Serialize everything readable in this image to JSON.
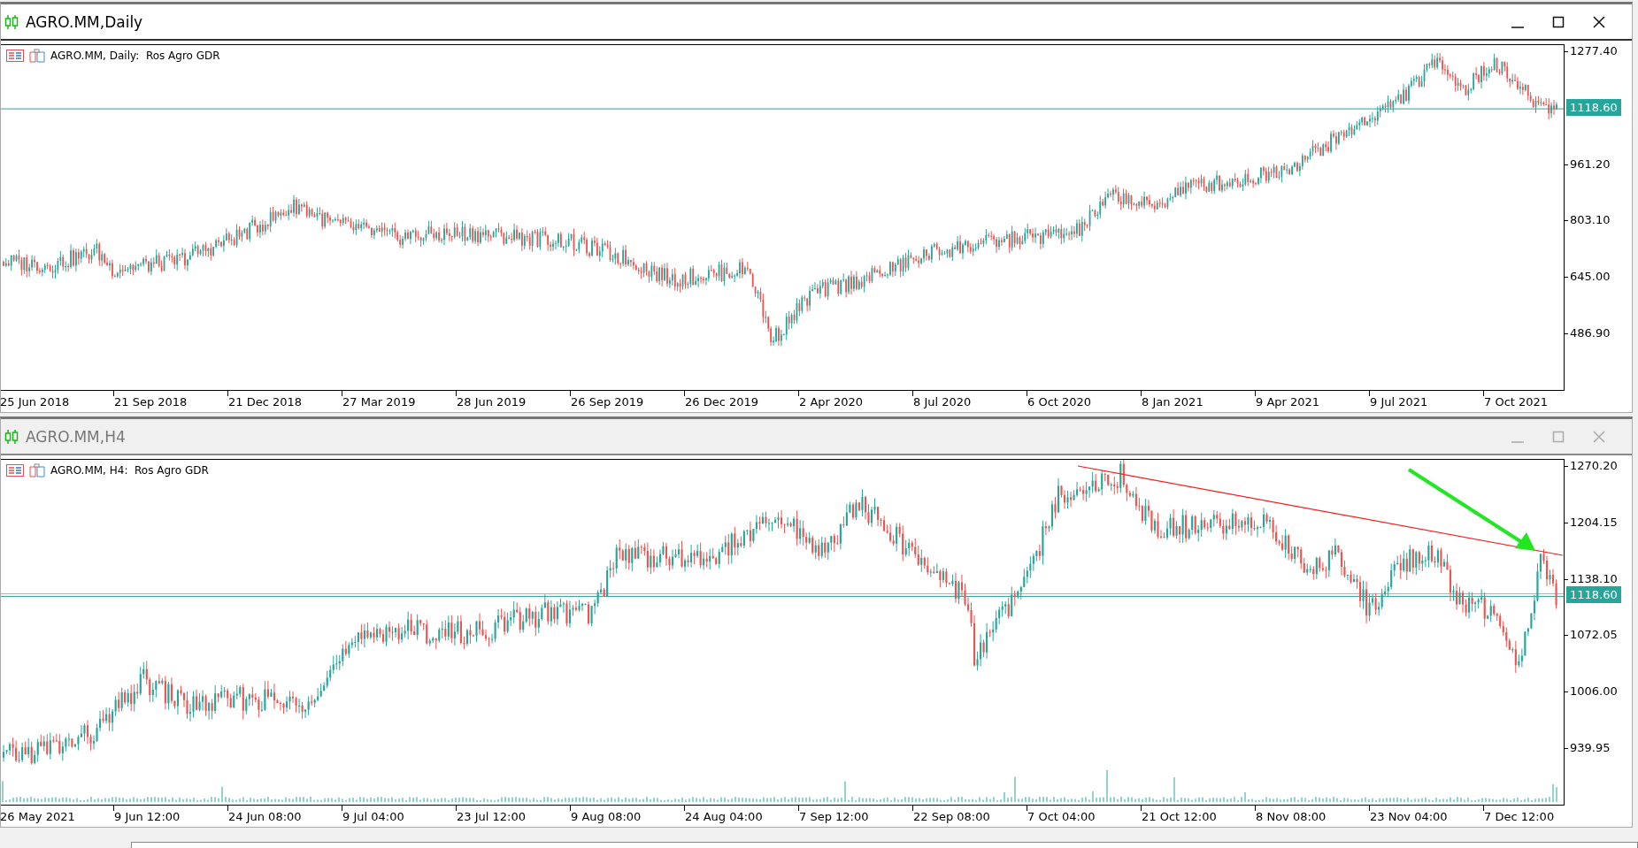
{
  "windows": [
    {
      "kind": "daily",
      "title": "AGRO.MM,Daily",
      "active": true,
      "legend": "AGRO.MM, Daily:  Ros Agro GDR",
      "price_axis": [
        "1277.40",
        "961.20",
        "803.10",
        "645.00",
        "486.90"
      ],
      "current_price": "1118.60",
      "time_axis": [
        "25 Jun 2018",
        "21 Sep 2018",
        "21 Dec 2018",
        "27 Mar 2019",
        "28 Jun 2019",
        "26 Sep 2019",
        "26 Dec 2019",
        "2 Apr 2020",
        "8 Jul 2020",
        "6 Oct 2020",
        "8 Jan 2021",
        "9 Apr 2021",
        "9 Jul 2021",
        "7 Oct 2021"
      ]
    },
    {
      "kind": "h4",
      "title": "AGRO.MM,H4",
      "active": false,
      "legend": "AGRO.MM, H4:  Ros Agro GDR",
      "price_axis": [
        "1270.20",
        "1204.15",
        "1138.10",
        "1072.05",
        "1006.00",
        "939.95"
      ],
      "current_price": "1118.60",
      "time_axis": [
        "26 May 2021",
        "9 Jun 12:00",
        "24 Jun 08:00",
        "9 Jul 04:00",
        "23 Jul 12:00",
        "9 Aug 08:00",
        "24 Aug 04:00",
        "7 Sep 12:00",
        "22 Sep 08:00",
        "7 Oct 04:00",
        "21 Oct 12:00",
        "8 Nov 08:00",
        "23 Nov 04:00",
        "7 Dec 12:00"
      ]
    }
  ]
}
